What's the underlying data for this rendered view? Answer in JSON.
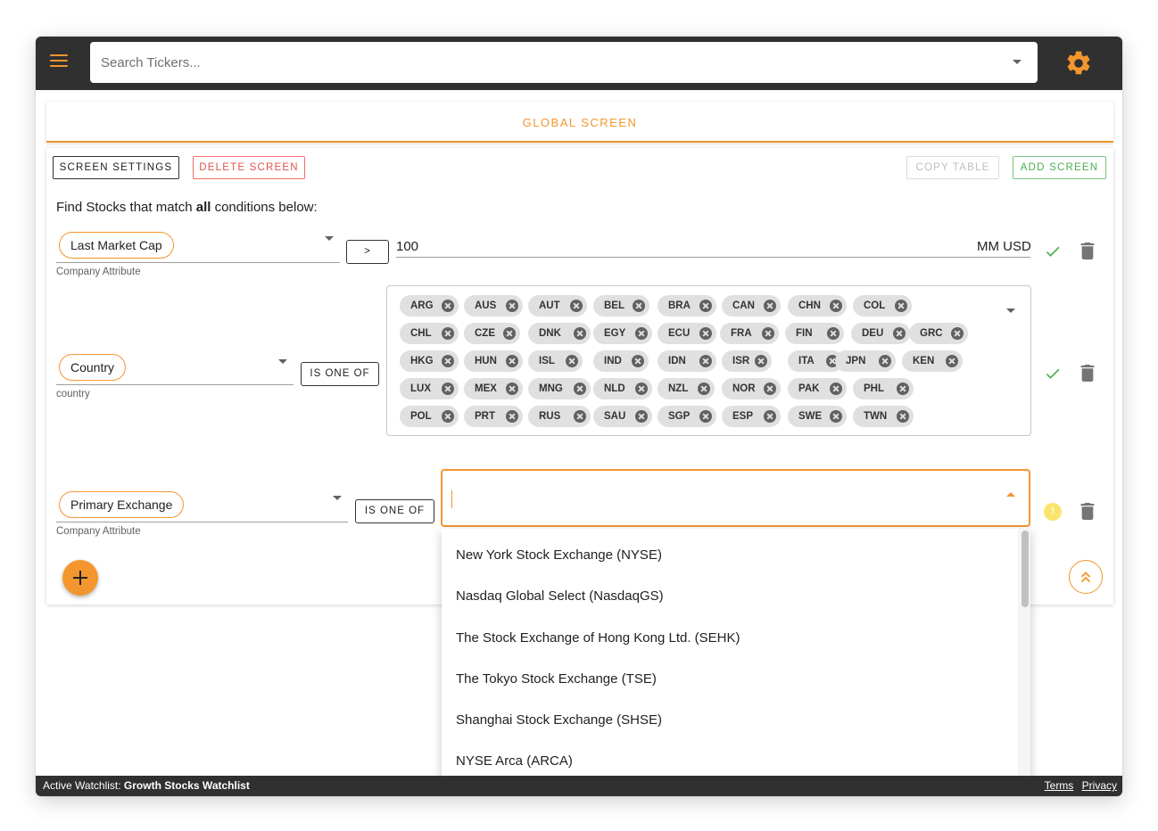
{
  "search": {
    "placeholder": "Search Tickers..."
  },
  "tab": {
    "label": "GLOBAL SCREEN"
  },
  "toolbar": {
    "screen_settings": "SCREEN SETTINGS",
    "delete_screen": "DELETE SCREEN",
    "copy_table": "COPY TABLE",
    "add_screen": "ADD SCREEN"
  },
  "instructions": {
    "prefix": "Find Stocks that match ",
    "emphasis": "all",
    "suffix": " conditions below:"
  },
  "conditions": [
    {
      "field": "Last Market Cap",
      "helper": "Company Attribute",
      "operator": ">",
      "value": "100",
      "unit": "MM USD",
      "status": "valid"
    },
    {
      "field": "Country",
      "helper": "country",
      "operator": "IS ONE OF",
      "status": "valid",
      "chips": [
        "ARG",
        "AUS",
        "AUT",
        "BEL",
        "BRA",
        "CAN",
        "CHN",
        "COL",
        "CHL",
        "CZE",
        "DNK",
        "EGY",
        "ECU",
        "FRA",
        "FIN",
        "DEU",
        "GRC",
        "HKG",
        "HUN",
        "ISL",
        "IND",
        "IDN",
        "ISR",
        "ITA",
        "JPN",
        "KEN",
        "LUX",
        "MEX",
        "MNG",
        "NLD",
        "NZL",
        "NOR",
        "PAK",
        "PHL",
        "POL",
        "PRT",
        "RUS",
        "SAU",
        "SGP",
        "ESP",
        "SWE",
        "TWN"
      ]
    },
    {
      "field": "Primary Exchange",
      "helper": "Company Attribute",
      "operator": "IS ONE OF",
      "status": "warning",
      "warning_glyph": "!"
    }
  ],
  "exchange_options": [
    "New York Stock Exchange (NYSE)",
    "Nasdaq Global Select (NasdaqGS)",
    "The Stock Exchange of Hong Kong Ltd. (SEHK)",
    "The Tokyo Stock Exchange (TSE)",
    "Shanghai Stock Exchange (SHSE)",
    "NYSE Arca (ARCA)"
  ],
  "footer": {
    "watchlist_label": "Active Watchlist: ",
    "watchlist_name": "Growth Stocks Watchlist",
    "terms": "Terms",
    "privacy": "Privacy"
  },
  "colors": {
    "accent": "#f4962e",
    "appbar": "#303030",
    "success": "#4caf50",
    "danger": "#e0524e",
    "warning": "#fbe46e"
  },
  "icons": {
    "menu": "hamburger-menu-icon",
    "settings": "gear-icon",
    "check": "check-icon",
    "trash": "trash-icon",
    "add": "plus-icon",
    "scroll_top": "double-chevron-up-icon"
  }
}
